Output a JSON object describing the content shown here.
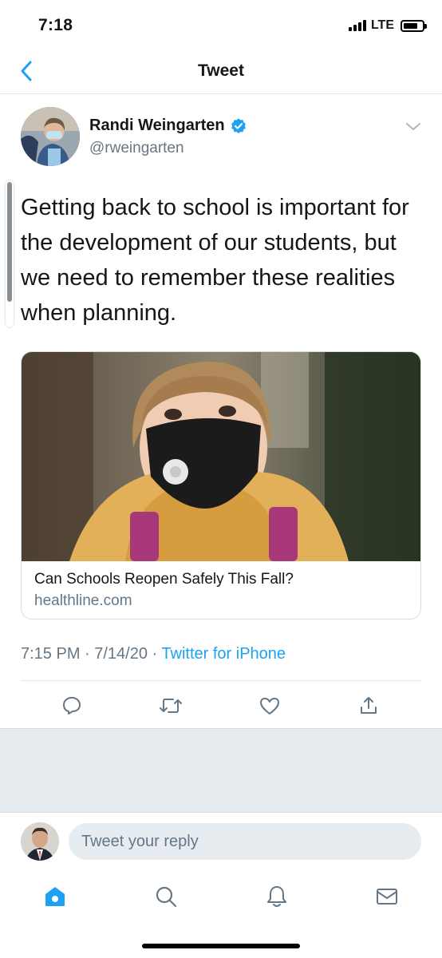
{
  "status_bar": {
    "time": "7:18",
    "network": "LTE"
  },
  "header": {
    "title": "Tweet"
  },
  "tweet": {
    "author_name": "Randi Weingarten",
    "handle": "@rweingarten",
    "verified": true,
    "text": "Getting back to school is important for the development of our students, but we need to remember these realities when planning.",
    "card": {
      "title": "Can Schools Reopen Safely This Fall?",
      "domain": "healthline.com"
    },
    "timestamp": "7:15 PM · 7/14/20 · ",
    "source": "Twitter for iPhone",
    "actions": [
      "reply-icon",
      "retweet-icon",
      "like-icon",
      "share-icon"
    ]
  },
  "reply": {
    "placeholder": "Tweet your reply"
  },
  "tab_bar": {
    "tabs": [
      "home-icon",
      "search-icon",
      "notifications-icon",
      "messages-icon"
    ],
    "active": "home-icon"
  },
  "colors": {
    "accent": "#1da1f2",
    "secondary_text": "#657786",
    "divider": "#e1e8ed",
    "gray_bg": "#e6ecf0"
  }
}
